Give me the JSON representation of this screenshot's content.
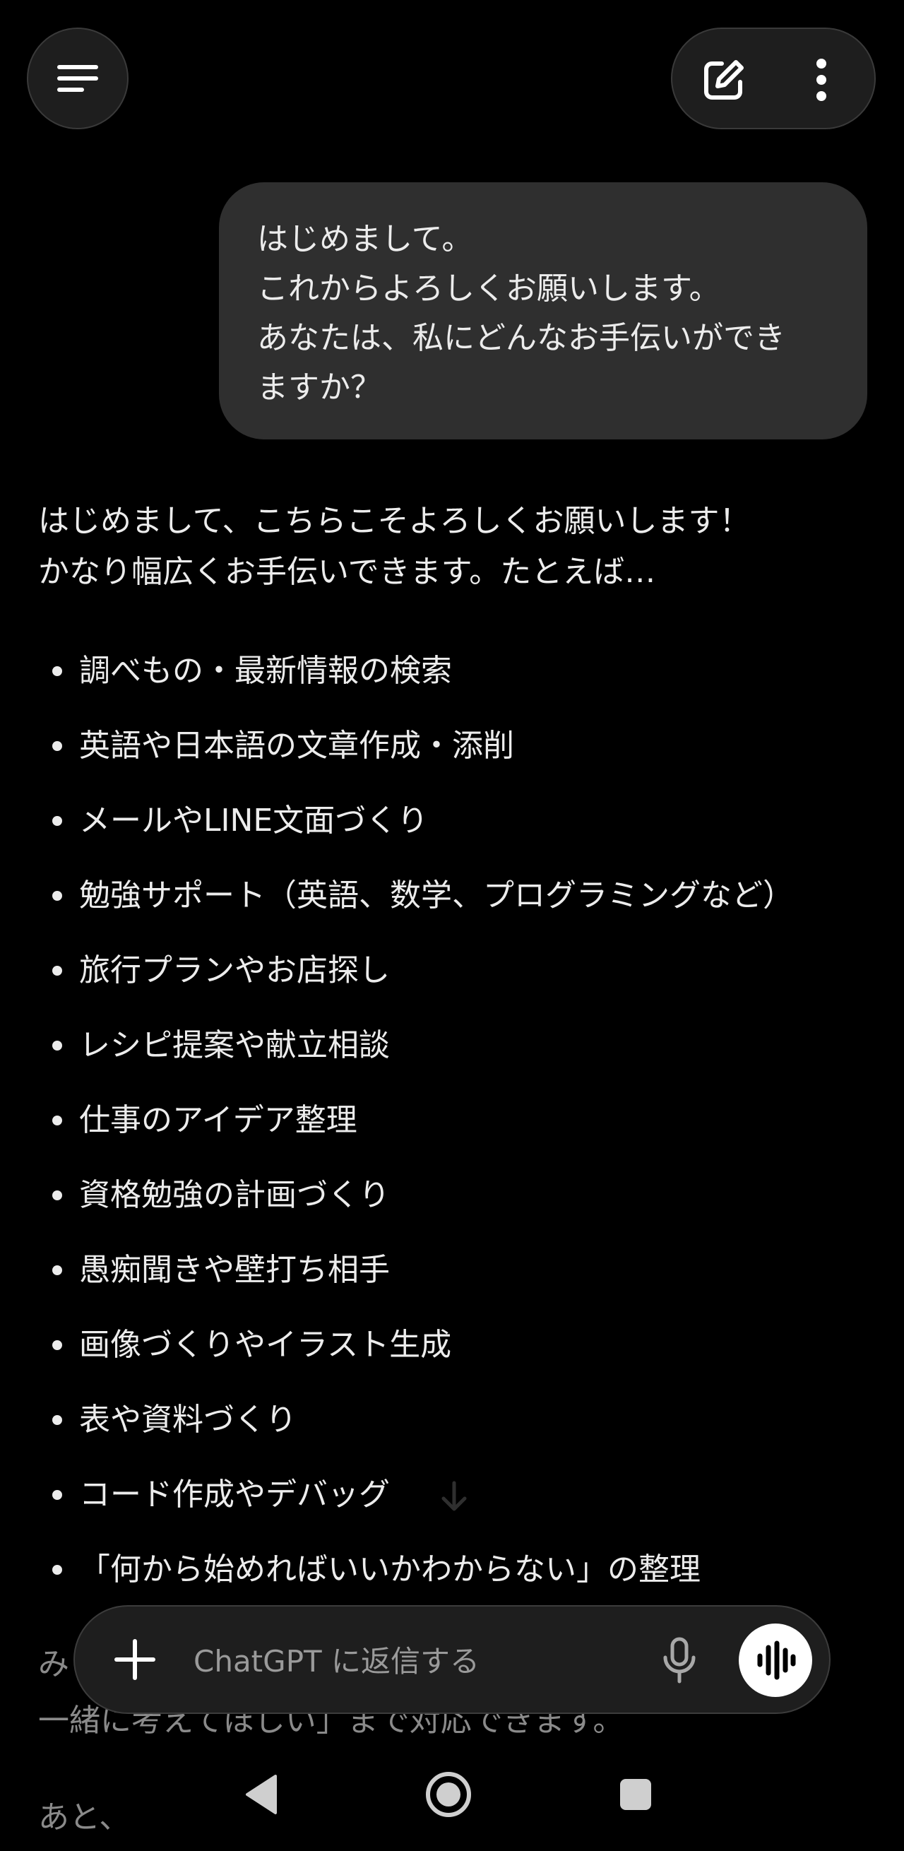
{
  "header": {
    "menu_icon": "menu-icon",
    "new_chat_icon": "new-chat-icon",
    "more_icon": "more-vertical-icon"
  },
  "conversation": {
    "user_message": {
      "lines": [
        "はじめまして。",
        "これからよろしくお願いします。",
        "あなたは、私にどんなお手伝いができ",
        "ますか？"
      ]
    },
    "assistant_message": {
      "intro_lines": [
        "はじめまして、こちらこそよろしくお願いします！",
        "かなり幅広くお手伝いできます。たとえば…"
      ],
      "bullets": [
        "調べもの・最新情報の検索",
        "英語や日本語の文章作成・添削",
        "メールやLINE文面づくり",
        "勉強サポート（英語、数学、プログラミングなど）",
        "旅行プランやお店探し",
        "レシピ提案や献立相談",
        "仕事のアイデア整理",
        "資格勉強の計画づくり",
        "愚痴聞きや壁打ち相手",
        "画像づくりやイラスト生成",
        "表や資料づくり",
        "コード作成やデバッグ",
        "「何から始めればいいかわからない」の整理"
      ],
      "trailing_partial_lines": [
        "み",
        "一緒に考えてほしい」まで対応できます。",
        "あと、"
      ]
    }
  },
  "composer": {
    "placeholder": "ChatGPT に返信する",
    "value": "",
    "plus_icon": "plus-icon",
    "mic_icon": "microphone-icon",
    "voice_icon": "voice-mode-icon"
  },
  "system_nav": {
    "back_icon": "back-triangle-icon",
    "home_icon": "home-circle-icon",
    "recents_icon": "recents-square-icon"
  },
  "colors": {
    "background": "#000000",
    "bubble": "#2f2f2f",
    "text": "#ececec",
    "muted_text": "#9a9a9a",
    "composer_bg": "#1e1e1e"
  }
}
